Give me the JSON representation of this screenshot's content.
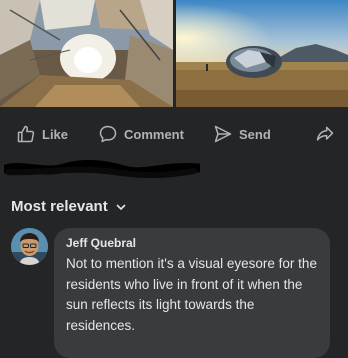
{
  "post": {
    "images": [
      {
        "name": "mirrored-tunnel-sculpture-photo"
      },
      {
        "name": "mirrored-sphere-sculpture-field-photo"
      }
    ]
  },
  "actions": {
    "like_label": "Like",
    "comment_label": "Comment",
    "send_label": "Send",
    "icons": {
      "like": "thumbs-up-icon",
      "comment": "speech-bubble-icon",
      "send": "paper-plane-icon",
      "share": "share-arrow-icon"
    }
  },
  "comments": {
    "sort_label": "Most relevant",
    "items": [
      {
        "author": "Jeff Quebral",
        "text": "Not to mention it's a visual eyesore for the residents who live in front of it when the sun reflects its light towards the residences."
      }
    ]
  },
  "colors": {
    "background": "#242526",
    "bubble": "#3a3b3c",
    "text_primary": "#e4e6eb",
    "text_secondary": "#b0b3b8"
  }
}
